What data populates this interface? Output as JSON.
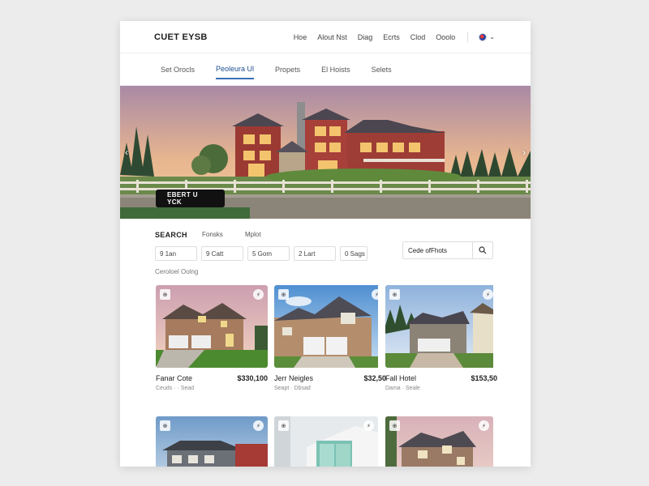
{
  "brand": "CUET EYSB",
  "topnav": [
    "Hoe",
    "Alout Nst",
    "Diag",
    "Ecrts",
    "Clod",
    "Ooolo"
  ],
  "subnav": {
    "items": [
      "Set Orocls",
      "Peoleura Ul",
      "Propets",
      "El Hoists",
      "Selets"
    ],
    "active": 1
  },
  "hero": {
    "button_label": "EBERT U YCK",
    "prev_arrow": "‹",
    "next_arrow": "›"
  },
  "search": {
    "title": "SEARCH",
    "tabs": [
      "Fonsks",
      "Mplot"
    ],
    "filters": [
      "9 1an",
      "9 Catt",
      "5 Gom",
      "2 Lart",
      "0 Sags"
    ],
    "caption": "Ceroloel Oolng",
    "input_value": "Cede ofFhots",
    "input_placeholder": ""
  },
  "listings": [
    {
      "name": "Fanar Cote",
      "price": "$330,100",
      "meta": "Ceuds · · Sead"
    },
    {
      "name": "Jerr Neigles",
      "price": "$32,50",
      "meta": "Seapt · Dbsad"
    },
    {
      "name": "Fall Hotel",
      "price": "$153,50",
      "meta": "Dama · Seale"
    },
    {
      "name": "",
      "price": "",
      "meta": ""
    },
    {
      "name": "",
      "price": "",
      "meta": ""
    },
    {
      "name": "",
      "price": "",
      "meta": ""
    }
  ],
  "icons": {
    "card_left": "⊕",
    "card_right": "⚡"
  }
}
